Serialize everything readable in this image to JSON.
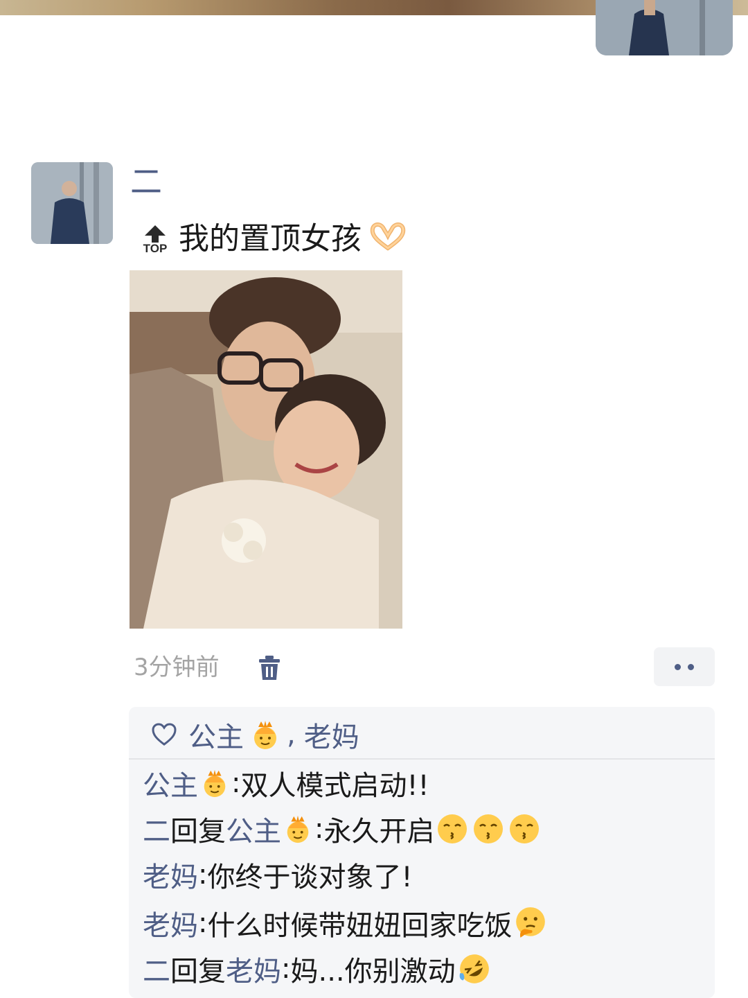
{
  "post": {
    "username": "二",
    "top_badge": "TOP",
    "text": "我的置顶女孩",
    "time": "3分钟前"
  },
  "likes": {
    "names": [
      "公主",
      "老妈"
    ],
    "separator": ","
  },
  "comments": [
    {
      "author": "公主",
      "reply_word": "",
      "reply_to": "",
      "separator": ": ",
      "text": "双人模式启动!!"
    },
    {
      "author": "二",
      "reply_word": "回复",
      "reply_to": "公主",
      "separator": ": ",
      "text": "永久开启"
    },
    {
      "author": "老妈",
      "reply_word": "",
      "reply_to": "",
      "separator": ": ",
      "text": "你终于谈对象了!"
    },
    {
      "author": "老妈",
      "reply_word": "",
      "reply_to": "",
      "separator": ": ",
      "text": "什么时候带妞妞回家吃饭"
    },
    {
      "author": "二",
      "reply_word": "回复",
      "reply_to": "老妈",
      "separator": ": ",
      "text": "妈...你别激动"
    }
  ],
  "colors": {
    "name_link": "#4f5e86",
    "time_gray": "#a4a4a4",
    "panel_bg": "#f5f6f8"
  },
  "icons": [
    "top-arrow-icon",
    "heart-hands-emoji",
    "trash-icon",
    "more-dots-icon",
    "heart-icon",
    "princess-crown-emoji",
    "kissing-face-emoji",
    "thinking-face-emoji",
    "rolling-laughing-emoji"
  ]
}
